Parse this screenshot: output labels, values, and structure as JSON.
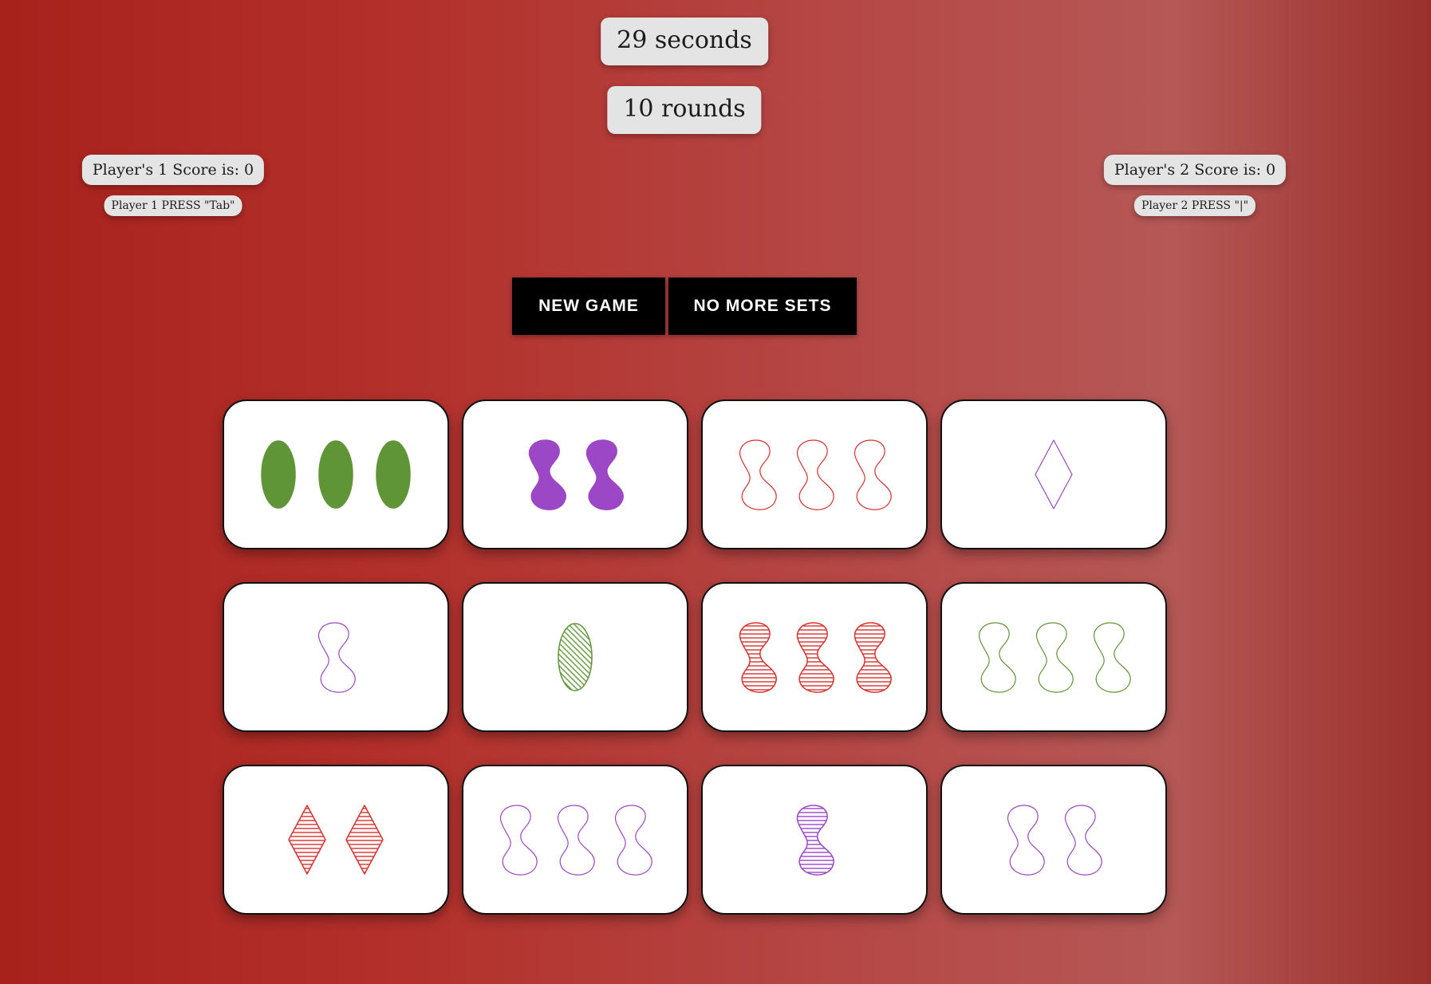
{
  "timer": "29 seconds",
  "rounds": "10 rounds",
  "players": [
    {
      "score_text": "Player's 1 Score is: 0",
      "hint": "Player 1 PRESS \"Tab\""
    },
    {
      "score_text": "Player's 2 Score is: 0",
      "hint": "Player 2 PRESS \"|\""
    }
  ],
  "buttons": {
    "new_game": "NEW GAME",
    "no_more_sets": "NO MORE SETS"
  },
  "colors": {
    "red": "#d9322e",
    "green": "#5f9536",
    "purple": "#9b47c6"
  },
  "cards": [
    {
      "count": 3,
      "shape": "oval",
      "color": "green",
      "fill": "solid"
    },
    {
      "count": 2,
      "shape": "squiggle",
      "color": "purple",
      "fill": "solid"
    },
    {
      "count": 3,
      "shape": "squiggle",
      "color": "red",
      "fill": "outline"
    },
    {
      "count": 1,
      "shape": "diamond",
      "color": "purple",
      "fill": "outline"
    },
    {
      "count": 1,
      "shape": "squiggle",
      "color": "purple",
      "fill": "outline"
    },
    {
      "count": 1,
      "shape": "oval",
      "color": "green",
      "fill": "striped"
    },
    {
      "count": 3,
      "shape": "squiggle",
      "color": "red",
      "fill": "striped"
    },
    {
      "count": 3,
      "shape": "squiggle",
      "color": "green",
      "fill": "outline"
    },
    {
      "count": 2,
      "shape": "diamond",
      "color": "red",
      "fill": "striped"
    },
    {
      "count": 3,
      "shape": "squiggle",
      "color": "purple",
      "fill": "outline"
    },
    {
      "count": 1,
      "shape": "squiggle",
      "color": "purple",
      "fill": "striped"
    },
    {
      "count": 2,
      "shape": "squiggle",
      "color": "purple",
      "fill": "outline"
    }
  ]
}
